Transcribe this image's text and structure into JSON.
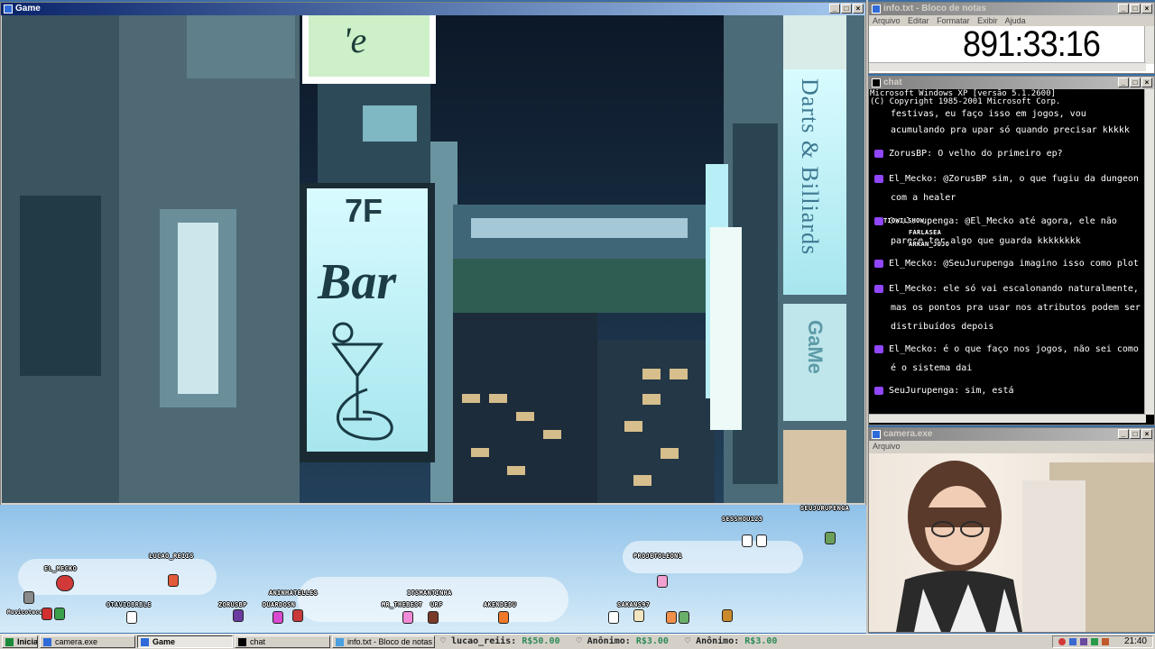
{
  "game_window": {
    "title": "Game"
  },
  "scene": {
    "bar_sign_floor": "7F",
    "bar_sign_text": "Bar",
    "top_sign_text": "'e",
    "vertical_sign_text": "Darts & Billiards",
    "game_sign_text": "GaMe"
  },
  "overlay": {
    "users": [
      {
        "name": "SESSHOU123"
      },
      {
        "name": "SEUJURUPENGA"
      },
      {
        "name": "EL_MECKO"
      },
      {
        "name": "LUCAO_REIIS"
      },
      {
        "name": "PROJETOLEON1"
      },
      {
        "name": "ANINHATELLES"
      },
      {
        "name": "ITSMANTINHA"
      },
      {
        "name": "OTAVIOBRBLE"
      },
      {
        "name": "ZORUSBP"
      },
      {
        "name": "DUARDOSN"
      },
      {
        "name": "MR_THEBEST"
      },
      {
        "name": "URF"
      },
      {
        "name": "AKENDEDU"
      },
      {
        "name": "SAKANS97"
      },
      {
        "name": "Musicoteca"
      }
    ]
  },
  "notepad": {
    "title": "info.txt - Bloco de notas",
    "menu": [
      "Arquivo",
      "Editar",
      "Formatar",
      "Exibir",
      "Ajuda"
    ],
    "content": "891:33:16"
  },
  "chat_window": {
    "title": "chat",
    "header_lines": [
      "Microsoft Windows XP [versão 5.1.2600]",
      "(C) Copyright 1985-2001 Microsoft Corp."
    ],
    "messages": [
      {
        "user": "",
        "lines": [
          "festivas, eu faço isso em jogos, vou",
          "acumulando pra upar só quando precisar kkkkk"
        ]
      },
      {
        "user": "ZorusBP",
        "lines": [
          "O velho do primeiro ep?"
        ]
      },
      {
        "user": "El_Mecko",
        "lines": [
          "@ZorusBP sim, o que fugiu da dungeon",
          "com a healer"
        ]
      },
      {
        "user": "SeuJurupenga",
        "lines": [
          "@El_Mecko até agora, ele não",
          "parece ter algo que guarda kkkkkkkk"
        ]
      },
      {
        "user": "El_Mecko",
        "lines": [
          "@SeuJurupenga imagino isso como plot"
        ]
      },
      {
        "user": "El_Mecko",
        "lines": [
          "ele só vai escalonando naturalmente,",
          "mas os pontos pra usar nos atributos podem ser",
          "distribuídos depois"
        ]
      },
      {
        "user": "El_Mecko",
        "lines": [
          "é o que faço nos jogos, não sei como",
          "é o sistema dai"
        ]
      },
      {
        "user": "SeuJurupenga",
        "lines": [
          "sim, está"
        ]
      }
    ],
    "floating_labels": [
      "TIOWILSHOW",
      "FARLASEA",
      "ARKAN_JOJO"
    ]
  },
  "camera_window": {
    "title": "camera.exe",
    "menu": "Arquivo"
  },
  "taskbar": {
    "start_label": "Iniciar",
    "buttons": [
      {
        "label": "camera.exe"
      },
      {
        "label": "Game"
      },
      {
        "label": "chat"
      },
      {
        "label": "info.txt - Bloco de notas"
      }
    ],
    "ticker": [
      {
        "user": "lucao_reiis",
        "amount": "R$50.00"
      },
      {
        "user": "Anônimo",
        "amount": "R$3.00"
      },
      {
        "user": "Anônimo",
        "amount": "R$3.00"
      }
    ],
    "clock": "21:40"
  },
  "colors": {
    "accent_title": "#0a246a",
    "donation": "#2e8b57",
    "twitch_badge": "#9146ff"
  }
}
